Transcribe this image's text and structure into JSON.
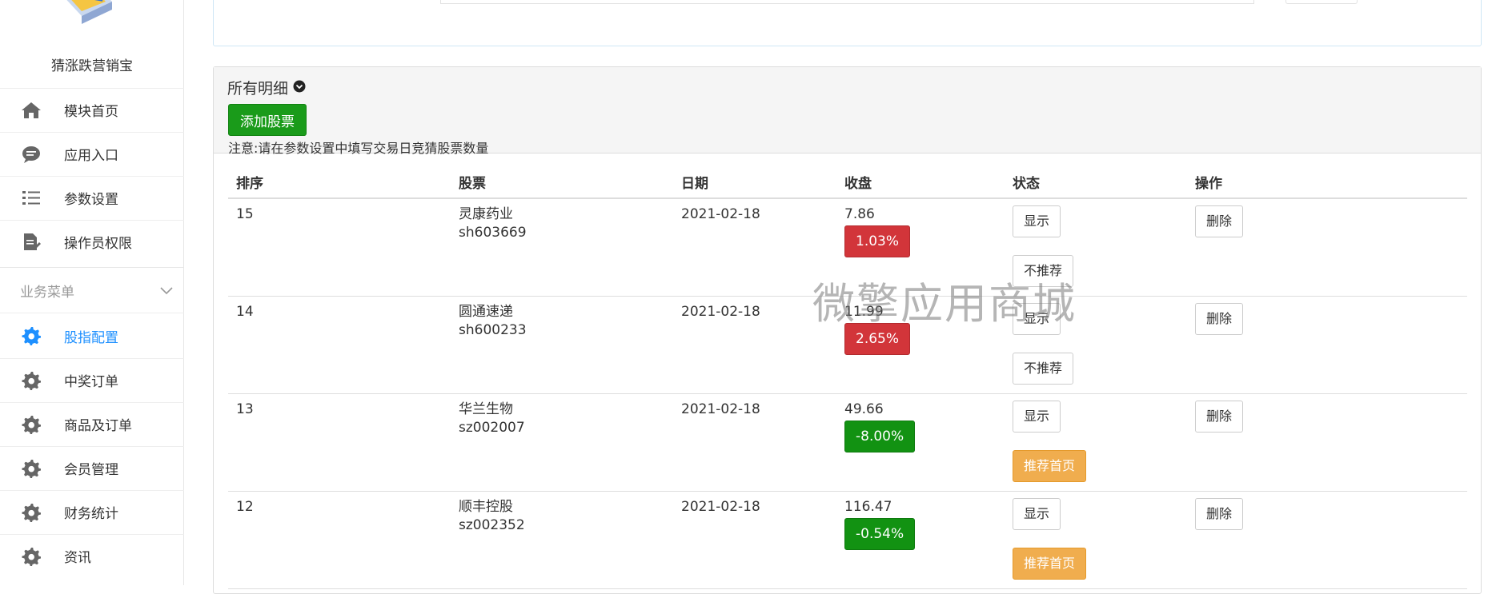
{
  "app": {
    "name": "猜涨跌营销宝"
  },
  "sidebar": {
    "items": [
      {
        "label": "模块首页",
        "icon": "home-icon"
      },
      {
        "label": "应用入口",
        "icon": "chat-icon"
      },
      {
        "label": "参数设置",
        "icon": "list-icon"
      },
      {
        "label": "操作员权限",
        "icon": "document-edit-icon"
      }
    ],
    "section": {
      "label": "业务菜单",
      "icon": "chevron-down-icon"
    },
    "business_items": [
      {
        "label": "股指配置",
        "icon": "gear-icon",
        "active": true
      },
      {
        "label": "中奖订单",
        "icon": "gear-icon"
      },
      {
        "label": "商品及订单",
        "icon": "gear-icon"
      },
      {
        "label": "会员管理",
        "icon": "gear-icon"
      },
      {
        "label": "财务统计",
        "icon": "gear-icon"
      },
      {
        "label": "资讯",
        "icon": "gear-icon"
      }
    ]
  },
  "panel": {
    "title": "所有明细",
    "add_button": "添加股票",
    "notice": "注意:请在参数设置中填写交易日竞猜股票数量"
  },
  "table": {
    "headers": [
      "排序",
      "股票",
      "日期",
      "收盘",
      "状态",
      "操作"
    ],
    "rows": [
      {
        "order": "15",
        "name": "灵康药业",
        "code": "sh603669",
        "date": "2021-02-18",
        "close": "7.86",
        "pct": "1.03%",
        "direction": "up",
        "show": "显示",
        "recommend": "不推荐",
        "recommend_style": "default",
        "delete": "删除"
      },
      {
        "order": "14",
        "name": "圆通速递",
        "code": "sh600233",
        "date": "2021-02-18",
        "close": "11.99",
        "pct": "2.65%",
        "direction": "up",
        "show": "显示",
        "recommend": "不推荐",
        "recommend_style": "default",
        "delete": "删除"
      },
      {
        "order": "13",
        "name": "华兰生物",
        "code": "sz002007",
        "date": "2021-02-18",
        "close": "49.66",
        "pct": "-8.00%",
        "direction": "down",
        "show": "显示",
        "recommend": "推荐首页",
        "recommend_style": "warning",
        "delete": "删除"
      },
      {
        "order": "12",
        "name": "顺丰控股",
        "code": "sz002352",
        "date": "2021-02-18",
        "close": "116.47",
        "pct": "-0.54%",
        "direction": "down",
        "show": "显示",
        "recommend": "推荐首页",
        "recommend_style": "warning",
        "delete": "删除"
      }
    ]
  },
  "watermark": "微擎应用商城",
  "colors": {
    "accent": "#1e90ff",
    "success": "#1a9b1a",
    "danger": "#d2353a",
    "warning": "#f0ad4e"
  }
}
